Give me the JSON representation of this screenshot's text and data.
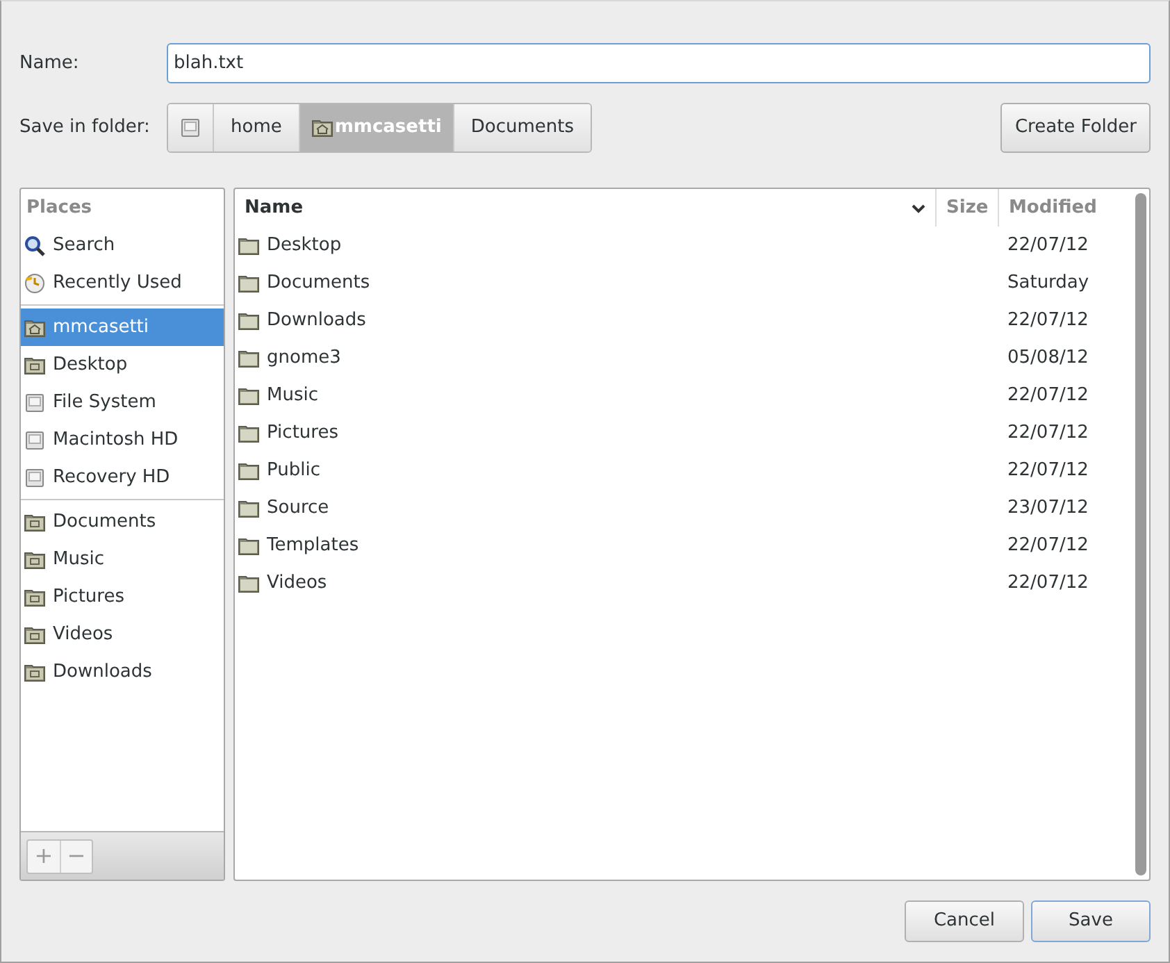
{
  "name_field": {
    "label": "Name:",
    "value": "blah.txt"
  },
  "save_in": {
    "label": "Save in folder:",
    "path": [
      {
        "kind": "drive",
        "selected": false
      },
      {
        "label": "home",
        "kind": "text",
        "selected": false
      },
      {
        "label": "mmcasetti",
        "kind": "home",
        "selected": true
      },
      {
        "label": "Documents",
        "kind": "text",
        "selected": false
      }
    ]
  },
  "create_folder_button": "Create Folder",
  "places": {
    "heading": "Places",
    "groups": [
      [
        {
          "label": "Search",
          "kind": "search",
          "selected": false
        },
        {
          "label": "Recently Used",
          "kind": "recent",
          "selected": false
        }
      ],
      [
        {
          "label": "mmcasetti",
          "kind": "home",
          "selected": true
        },
        {
          "label": "Desktop",
          "kind": "folder",
          "selected": false
        },
        {
          "label": "File System",
          "kind": "drive",
          "selected": false
        },
        {
          "label": "Macintosh HD",
          "kind": "drive",
          "selected": false
        },
        {
          "label": "Recovery HD",
          "kind": "drive",
          "selected": false
        }
      ],
      [
        {
          "label": "Documents",
          "kind": "folder",
          "selected": false
        },
        {
          "label": "Music",
          "kind": "folder",
          "selected": false
        },
        {
          "label": "Pictures",
          "kind": "folder",
          "selected": false
        },
        {
          "label": "Videos",
          "kind": "folder",
          "selected": false
        },
        {
          "label": "Downloads",
          "kind": "folder",
          "selected": false
        }
      ]
    ],
    "add_button": "+",
    "remove_button": "−"
  },
  "files": {
    "columns": [
      "Name",
      "Size",
      "Modified"
    ],
    "rows": [
      {
        "name": "Desktop",
        "modified": "22/07/12"
      },
      {
        "name": "Documents",
        "modified": "Saturday"
      },
      {
        "name": "Downloads",
        "modified": "22/07/12"
      },
      {
        "name": "gnome3",
        "modified": "05/08/12"
      },
      {
        "name": "Music",
        "modified": "22/07/12"
      },
      {
        "name": "Pictures",
        "modified": "22/07/12"
      },
      {
        "name": "Public",
        "modified": "22/07/12"
      },
      {
        "name": "Source",
        "modified": "23/07/12"
      },
      {
        "name": "Templates",
        "modified": "22/07/12"
      },
      {
        "name": "Videos",
        "modified": "22/07/12"
      }
    ]
  },
  "buttons": [
    "Cancel",
    "Save"
  ]
}
